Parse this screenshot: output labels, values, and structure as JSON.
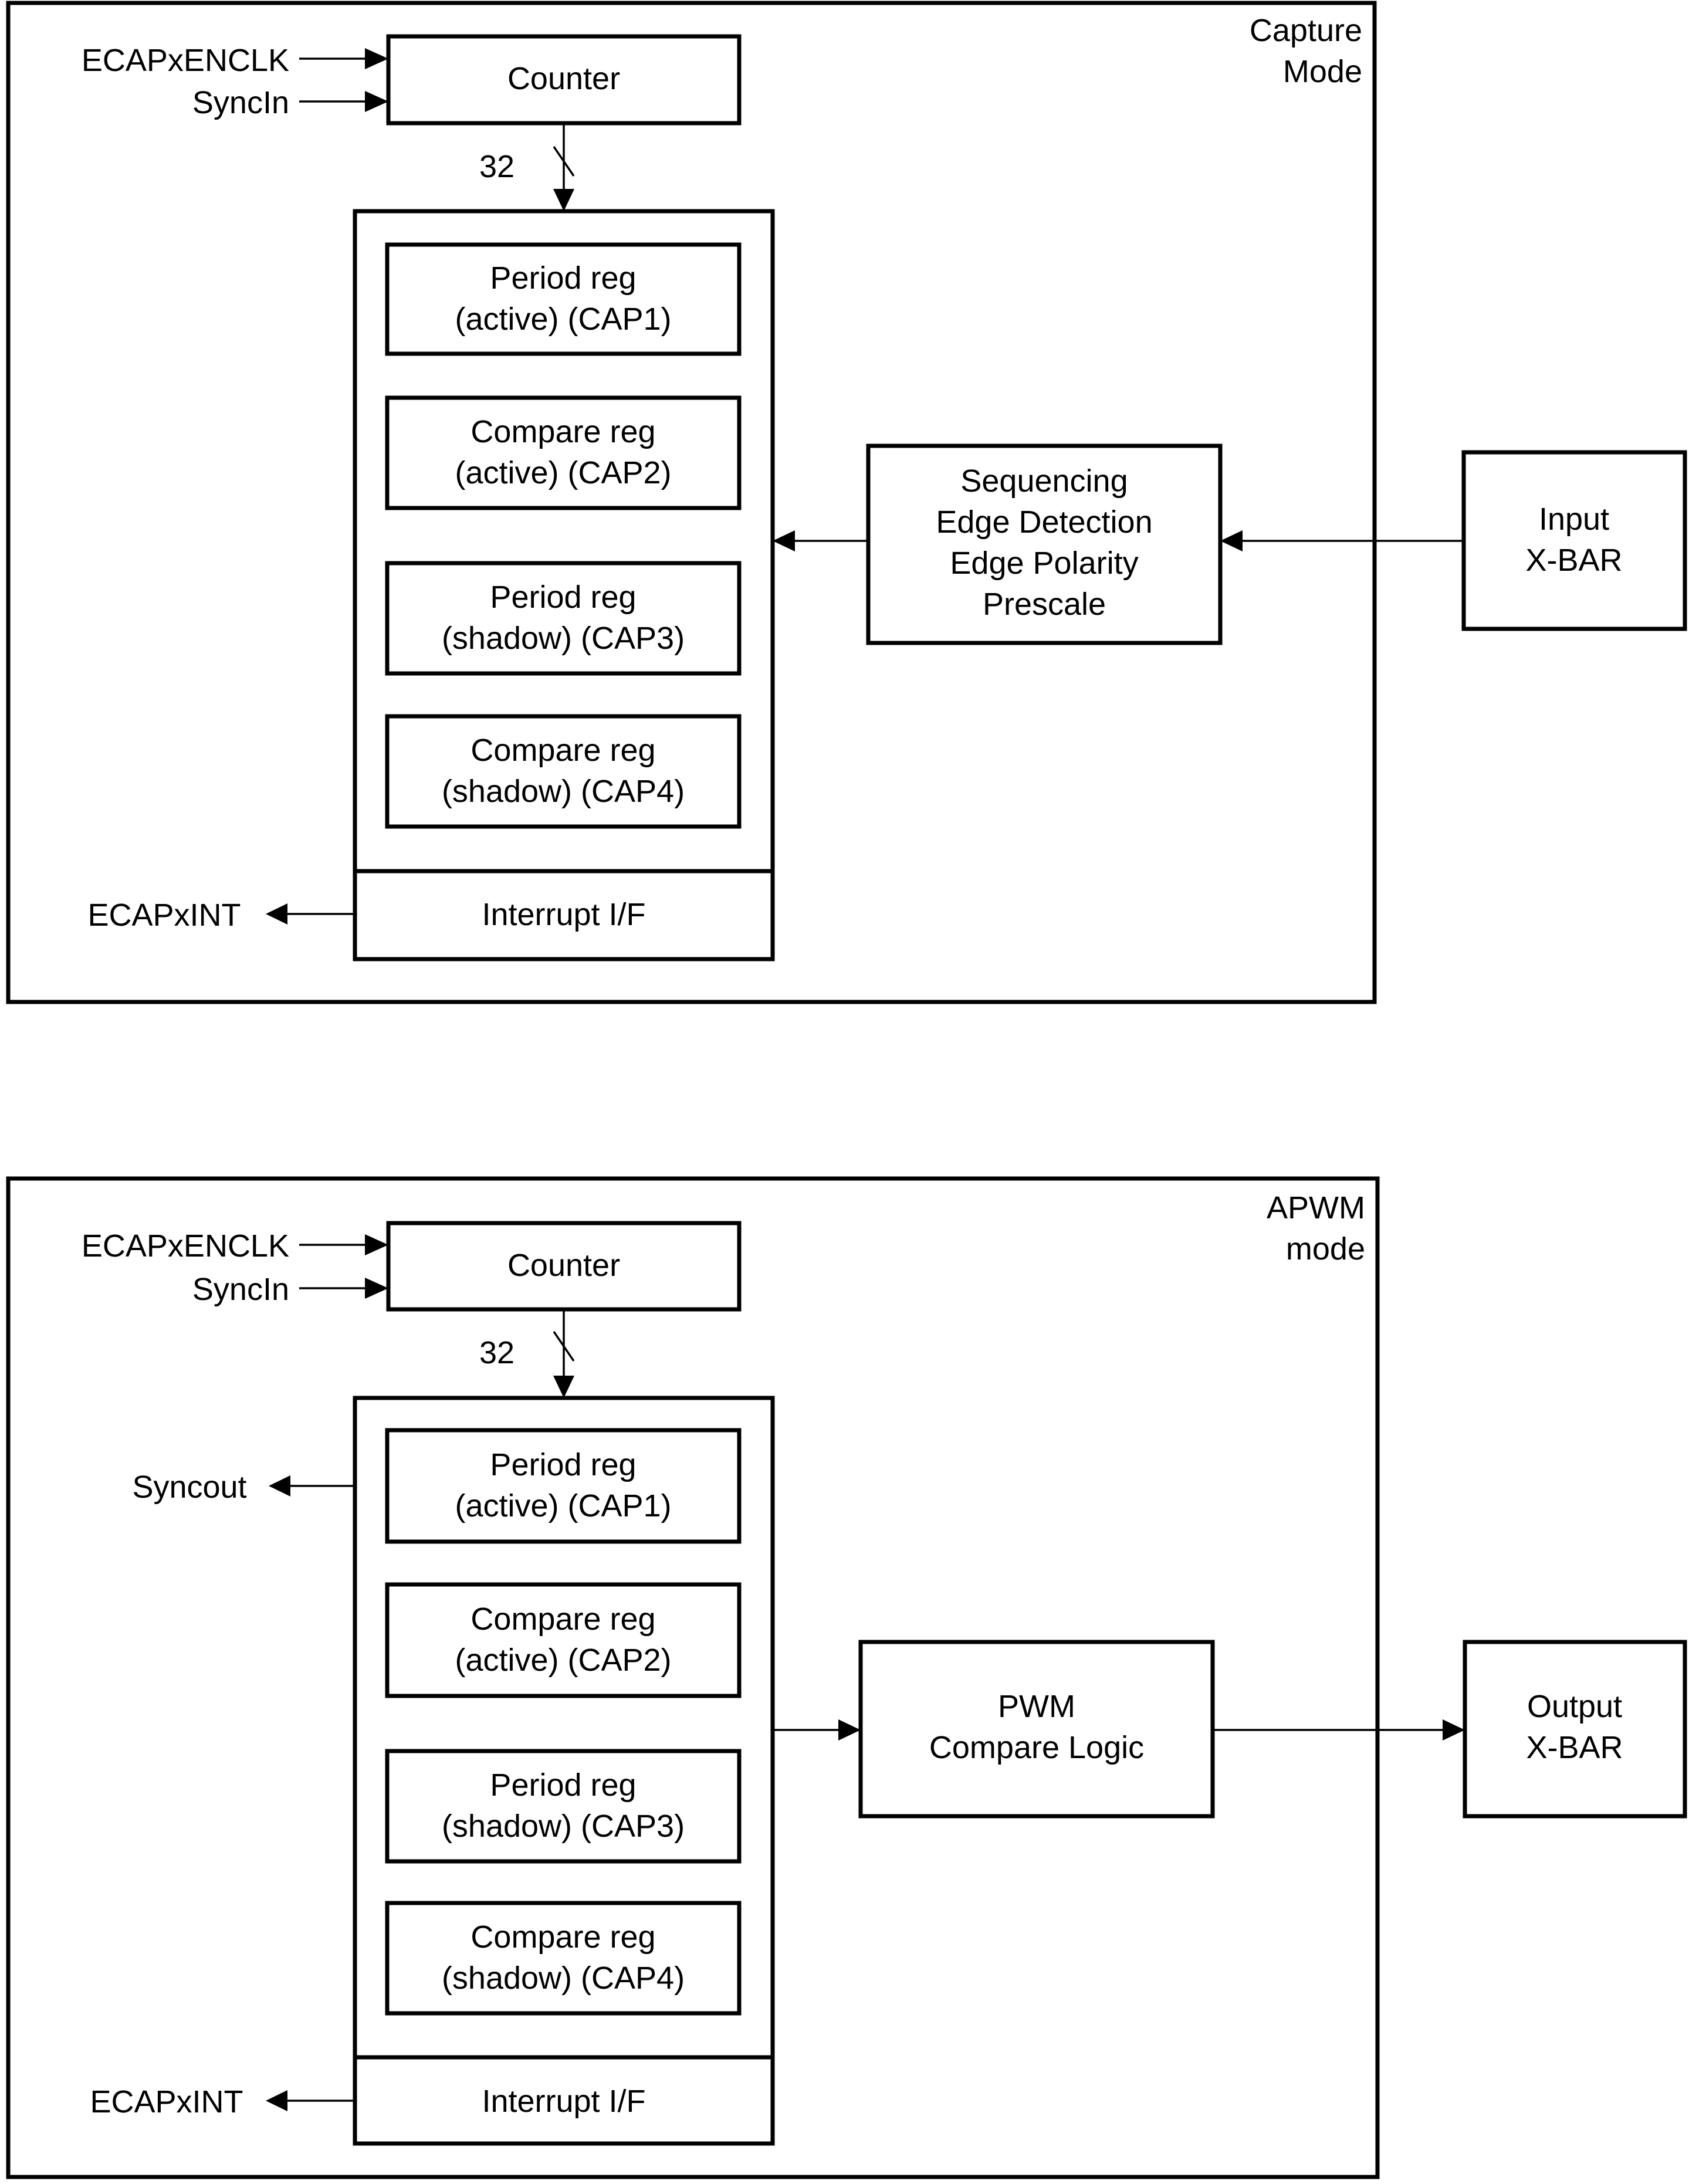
{
  "diagram": {
    "colors": {
      "line": "#000000",
      "background": "#ffffff"
    },
    "capture": {
      "mode_label": [
        "Capture",
        "Mode"
      ],
      "inputs": [
        "ECAPxENCLK",
        "SyncIn"
      ],
      "counter": "Counter",
      "bus_width": "32",
      "registers": [
        [
          "Period reg",
          "(active) (CAP1)"
        ],
        [
          "Compare reg",
          "(active) (CAP2)"
        ],
        [
          "Period reg",
          "(shadow) (CAP3)"
        ],
        [
          "Compare reg",
          "(shadow) (CAP4)"
        ]
      ],
      "interrupt": "Interrupt I/F",
      "interrupt_out": "ECAPxINT",
      "logic": [
        "Sequencing",
        "Edge Detection",
        "Edge Polarity",
        "Prescale"
      ],
      "xbar": [
        "Input",
        "X-BAR"
      ]
    },
    "apwm": {
      "mode_label": [
        "APWM",
        "mode"
      ],
      "inputs": [
        "ECAPxENCLK",
        "SyncIn"
      ],
      "counter": "Counter",
      "bus_width": "32",
      "sync_out": "Syncout",
      "registers": [
        [
          "Period reg",
          "(active) (CAP1)"
        ],
        [
          "Compare reg",
          "(active) (CAP2)"
        ],
        [
          "Period reg",
          "(shadow) (CAP3)"
        ],
        [
          "Compare reg",
          "(shadow) (CAP4)"
        ]
      ],
      "interrupt": "Interrupt I/F",
      "interrupt_out": "ECAPxINT",
      "logic": [
        "PWM",
        "Compare Logic"
      ],
      "xbar": [
        "Output",
        "X-BAR"
      ]
    }
  }
}
